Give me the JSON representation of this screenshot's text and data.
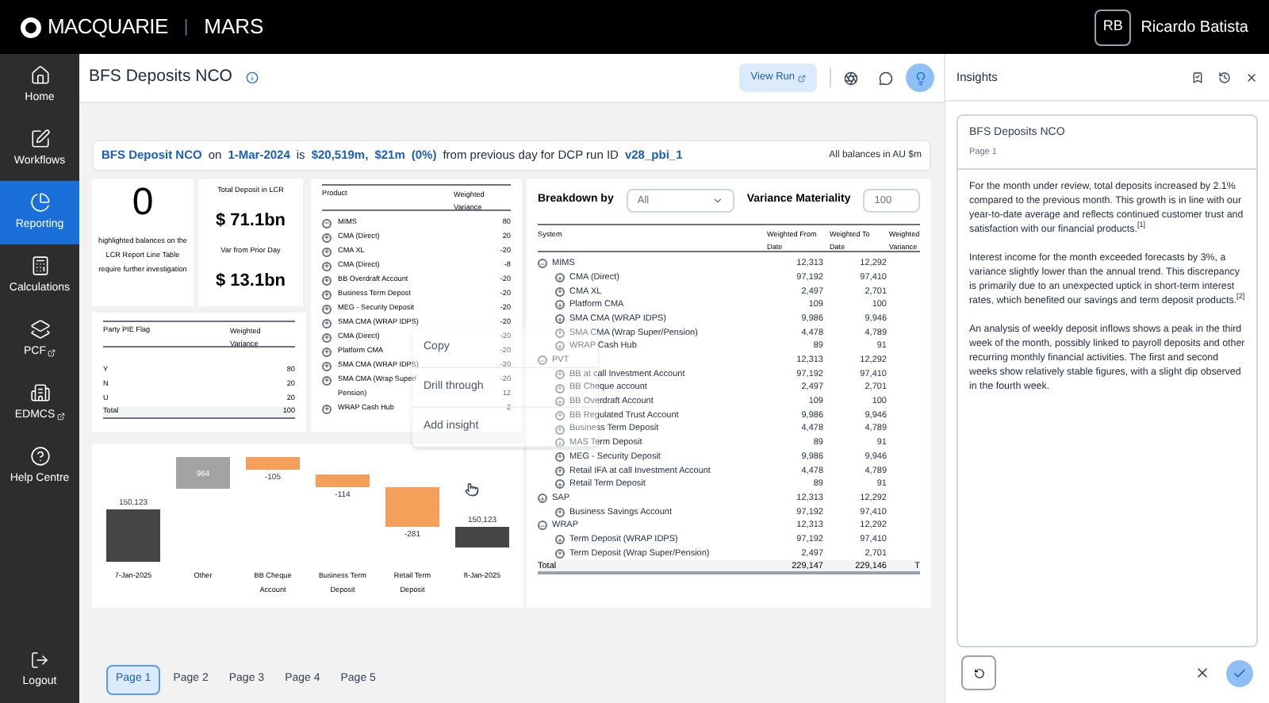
{
  "topbar": {
    "logo_text": "MACQUARIE",
    "divider": "|",
    "app_name": "MARS",
    "user_initials": "RB",
    "user_name": "Ricardo Batista"
  },
  "sidebar": {
    "items": [
      {
        "label": "Home",
        "kind": "home",
        "selected": false,
        "external": false
      },
      {
        "label": "Workflows",
        "kind": "workflows",
        "selected": false,
        "external": false
      },
      {
        "label": "Reporting",
        "kind": "reporting",
        "selected": true,
        "external": false
      },
      {
        "label": "Calculations",
        "kind": "calculations",
        "selected": false,
        "external": false
      },
      {
        "label": "PCF",
        "kind": "pcf",
        "selected": false,
        "external": true
      },
      {
        "label": "EDMCS",
        "kind": "edmcs",
        "selected": false,
        "external": true
      },
      {
        "label": "Help Centre",
        "kind": "help",
        "selected": false,
        "external": false
      }
    ],
    "footer_item": {
      "label": "Logout"
    }
  },
  "page_header": {
    "title": "BFS Deposits NCO",
    "view_run": "View Run",
    "insights_active": true
  },
  "banner": {
    "parts": [
      {
        "text": "BFS Deposit NCO",
        "highlight": true
      },
      {
        "text": "on",
        "highlight": false
      },
      {
        "text": "1-Mar-2024",
        "highlight": true
      },
      {
        "text": "is",
        "highlight": false
      },
      {
        "text": "$20,519m,",
        "highlight": true
      },
      {
        "text": "$21m",
        "highlight": true
      },
      {
        "text": "(0%)",
        "highlight": true
      },
      {
        "text": "from previous day for DCP run ID",
        "highlight": false
      },
      {
        "text": "v28_pbi_1",
        "highlight": true
      }
    ],
    "note": "All balances in AU $m"
  },
  "highlight_card": {
    "count": "0",
    "text": "highlighted balances on the LCR Report Line Table require further investigation"
  },
  "totals_card": {
    "label_1": "Total Deposit in LCR",
    "value_1": "$ 71.1bn",
    "label_2": "Var from Prior Day",
    "value_2": "$ 13.1bn"
  },
  "party_table": {
    "columns": [
      "Party PIE Flag",
      "Weighted Variance"
    ],
    "rows": [
      {
        "flag": "Y",
        "variance": "80"
      },
      {
        "flag": "N",
        "variance": "20"
      },
      {
        "flag": "U",
        "variance": "20"
      }
    ],
    "total": {
      "label": "Total",
      "variance": "100"
    }
  },
  "product_table": {
    "columns": [
      "Product",
      "Weighted Variance"
    ],
    "rows": [
      {
        "name": "MIMS",
        "variance": "80",
        "kind": "expanded"
      },
      {
        "name": "CMA (Direct)",
        "variance": "20",
        "kind": "collapsed"
      },
      {
        "name": "CMA XL",
        "variance": "-20",
        "kind": "collapsed"
      },
      {
        "name": "CMA (Direct)",
        "variance": "-8",
        "kind": "collapsed"
      },
      {
        "name": "BB Overdraft Account",
        "variance": "-20",
        "kind": "collapsed"
      },
      {
        "name": "Business Term Depost",
        "variance": "-20",
        "kind": "collapsed"
      },
      {
        "name": "MEG - Security Deposit",
        "variance": "-20",
        "kind": "collapsed"
      },
      {
        "name": "SMA CMA (WRAP IDPS)",
        "variance": "-20",
        "kind": "collapsed"
      },
      {
        "name": "CMA (Direct)",
        "variance": "-20",
        "kind": "collapsed"
      },
      {
        "name": "Platform CMA",
        "variance": "-20",
        "kind": "collapsed"
      },
      {
        "name": "SMA CMA (WRAP IDPS)",
        "variance": "-20",
        "kind": "collapsed"
      },
      {
        "name": "SMA CMA (Wrap Super/",
        "variance": "-20",
        "kind": "collapsed"
      },
      {
        "name": "Pension)",
        "variance": "12",
        "kind": "text"
      },
      {
        "name": "WRAP Cash Hub",
        "variance": "2",
        "kind": "collapsed"
      }
    ]
  },
  "context_menu": {
    "items": [
      "Copy",
      "Drill through",
      "Add insight"
    ]
  },
  "filters": {
    "breakdown_label": "Breakdown by",
    "breakdown_value": "All",
    "materiality_label": "Variance Materiality",
    "materiality_value": "100"
  },
  "system_table": {
    "columns": [
      "System",
      "Weighted From Date",
      "Weighted To Date",
      "Weighted Variance"
    ],
    "rows": [
      {
        "name": "MIMS",
        "from": "12,313",
        "to": "12,292",
        "expanded": true,
        "children": [
          {
            "name": "CMA (Direct)",
            "from": "97,192",
            "to": "97,410",
            "expanded": false
          },
          {
            "name": "CMA XL",
            "from": "2,497",
            "to": "2,701",
            "expanded": false
          },
          {
            "name": "Platform CMA",
            "from": "109",
            "to": "100",
            "expanded": false
          },
          {
            "name": "SMA CMA (WRAP IDPS)",
            "from": "9,986",
            "to": "9,946",
            "expanded": false
          },
          {
            "name": "SMA CMA (Wrap Super/Pension)",
            "from": "4,478",
            "to": "4,789",
            "expanded": false
          },
          {
            "name": "WRAP Cash Hub",
            "from": "89",
            "to": "91",
            "expanded": false
          }
        ]
      },
      {
        "name": "PVT",
        "from": "12,313",
        "to": "12,292",
        "expanded": true,
        "children": [
          {
            "name": "BB at call Investment Account",
            "from": "97,192",
            "to": "97,410",
            "expanded": false
          },
          {
            "name": "BB Cheque account",
            "from": "2,497",
            "to": "2,701",
            "expanded": false
          },
          {
            "name": "BB Overdraft Account",
            "from": "109",
            "to": "100",
            "expanded": false
          },
          {
            "name": "BB Regulated Trust Account",
            "from": "9,986",
            "to": "9,946",
            "expanded": false
          },
          {
            "name": "Business Term Deposit",
            "from": "4,478",
            "to": "4,789",
            "expanded": false
          },
          {
            "name": "MAS Term Deposit",
            "from": "89",
            "to": "91",
            "expanded": false
          },
          {
            "name": "MEG - Security Deposit",
            "from": "9,986",
            "to": "9,946",
            "expanded": false
          },
          {
            "name": "Retail IFA at call Investment Account",
            "from": "4,478",
            "to": "4,789",
            "expanded": false
          },
          {
            "name": "Retail Term Deposit",
            "from": "89",
            "to": "91",
            "expanded": false
          }
        ]
      },
      {
        "name": "SAP",
        "from": "12,313",
        "to": "12,292",
        "expanded": false,
        "children": [
          {
            "name": "Business Savings Account",
            "from": "97,192",
            "to": "97,410",
            "expanded": false
          }
        ]
      },
      {
        "name": "WRAP",
        "from": "12,313",
        "to": "12,292",
        "expanded": true,
        "children": [
          {
            "name": "Term Deposit (WRAP IDPS)",
            "from": "97,192",
            "to": "97,410",
            "expanded": false
          },
          {
            "name": "Term Deposit (Wrap Super/Pension)",
            "from": "2,497",
            "to": "2,701",
            "expanded": false
          }
        ]
      }
    ],
    "total": {
      "label": "Total",
      "from": "229,147",
      "to": "229,146",
      "variance": "T"
    }
  },
  "waterfall": {
    "bars": [
      {
        "category": "7-Jan-2025",
        "label": "150,123",
        "kind": "total"
      },
      {
        "category": "Other",
        "label": "964",
        "kind": "increase"
      },
      {
        "category": "BB Cheque Account",
        "label": "-105",
        "kind": "decrease"
      },
      {
        "category": "Business Term Deposit",
        "label": "-114",
        "kind": "decrease"
      },
      {
        "category": "Retail Term Deposit",
        "label": "-281",
        "kind": "decrease"
      },
      {
        "category": "8-Jan-2025",
        "label": "150,123",
        "kind": "total"
      }
    ]
  },
  "pagination": [
    {
      "label": "Page 1",
      "selected": true
    },
    {
      "label": "Page 2",
      "selected": false
    },
    {
      "label": "Page 3",
      "selected": false
    },
    {
      "label": "Page 4",
      "selected": false
    },
    {
      "label": "Page 5",
      "selected": false
    }
  ],
  "insights": {
    "title": "Insights",
    "card_title": "BFS Deposits NCO",
    "card_subtitle": "Page 1",
    "paragraphs": [
      "For the month under review, total deposits increased by 2.1% compared to the previous month. This growth is in line with our year-to-date average and reflects continued customer trust and satisfaction with our financial products.$^{[1]}$",
      "Interest income for the month exceeded forecasts by 3%, a variance slightly lower than the annual trend. This discrepancy is primarily due to an unexpected uptick in short-term interest rates, which benefited our savings and term deposit products.$^{[2]}$",
      "An analysis of weekly deposit inflows shows a peak in the third week of the month, possibly linked to payroll deposits and other recurring monthly financial activities. The first and second weeks show relatively stable figures, with a slight dip observed in the fourth week."
    ]
  }
}
